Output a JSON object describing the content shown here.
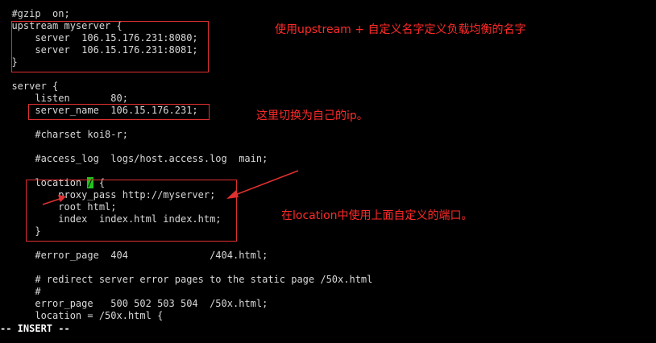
{
  "editor": {
    "lines": [
      "  #gzip  on;",
      "  upstream myserver {",
      "      server  106.15.176.231:8080;",
      "      server  106.15.176.231:8081;",
      "  }",
      "",
      "  server {",
      "      listen       80;",
      "      server_name  106.15.176.231;",
      "",
      "      #charset koi8-r;",
      "",
      "      #access_log  logs/host.access.log  main;",
      "",
      "      location / {",
      "          proxy_pass http://myserver;",
      "          root html;",
      "          index  index.html index.htm;",
      "      }",
      "",
      "      #error_page  404              /404.html;",
      "",
      "      # redirect server error pages to the static page /50x.html",
      "      #",
      "      error_page   500 502 503 504  /50x.html;",
      "      location = /50x.html {"
    ],
    "location_prefix": "      location ",
    "cursor_char": "/",
    "location_suffix": " {",
    "mode": "-- INSERT --"
  },
  "annotations": {
    "upstream_note": "使用upstream + 自定义名字定义负载均衡的名字",
    "ip_note": "这里切换为自己的ip。",
    "location_note": "在location中使用上面自定义的端口。"
  },
  "colors": {
    "background": "#000000",
    "text": "#d8d8d8",
    "cursor": "#22c31f",
    "annotation": "#ff2a2a"
  }
}
